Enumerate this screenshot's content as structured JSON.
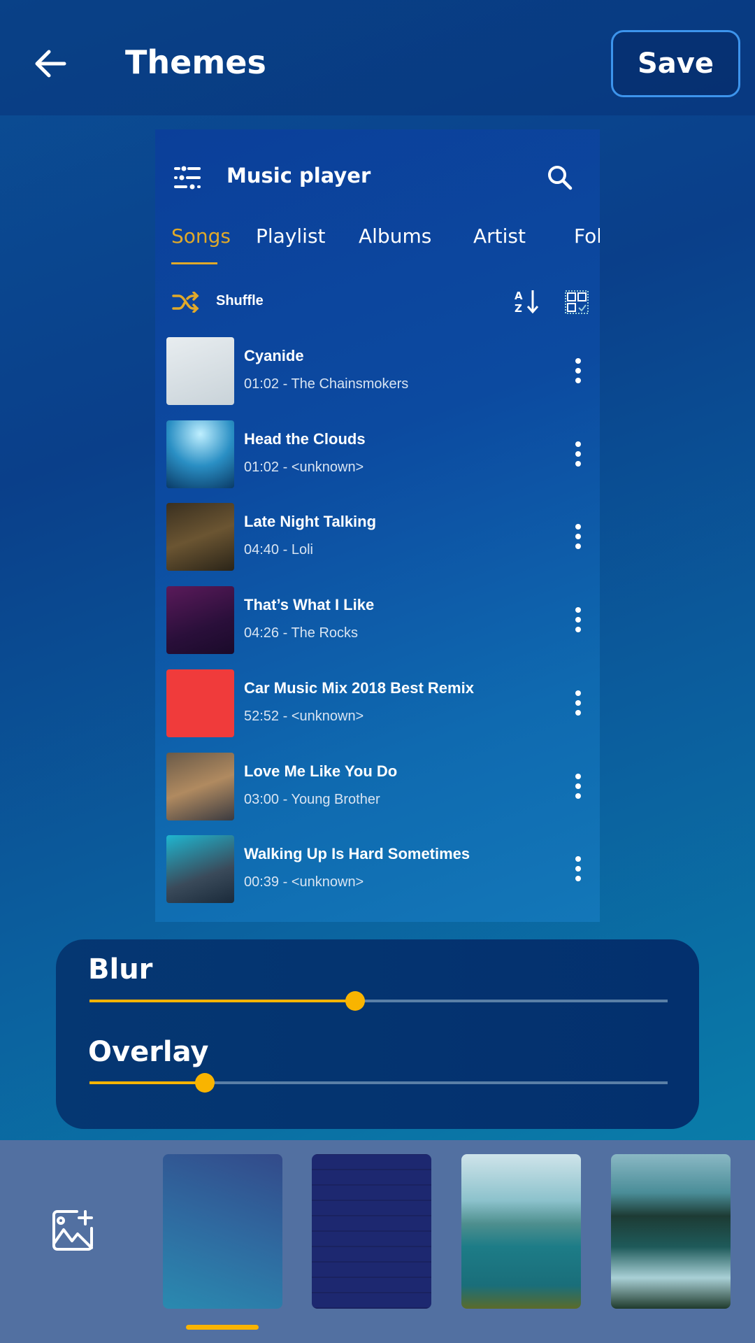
{
  "header": {
    "title": "Themes",
    "save_label": "Save",
    "back_icon": "arrow-left-icon"
  },
  "preview": {
    "title": "Music player",
    "tabs": [
      {
        "label": "Songs",
        "active": true
      },
      {
        "label": "Playlist"
      },
      {
        "label": "Albums"
      },
      {
        "label": "Artist"
      },
      {
        "label": "Fol"
      }
    ],
    "shuffle_label": "Shuffle",
    "accent": "#e0a92a",
    "songs": [
      {
        "title": "Cyanide",
        "subtitle": "01:02 - The Chainsmokers"
      },
      {
        "title": "Head the Clouds",
        "subtitle": "01:02 - <unknown>"
      },
      {
        "title": "Late Night Talking",
        "subtitle": "04:40 - Loli"
      },
      {
        "title": "That’s What I Like",
        "subtitle": "04:26 - The Rocks"
      },
      {
        "title": "Car Music Mix 2018 Best Remix",
        "subtitle": "52:52 - <unknown>"
      },
      {
        "title": "Love Me Like You Do",
        "subtitle": "03:00 - Young Brother"
      },
      {
        "title": "Walking Up Is Hard Sometimes",
        "subtitle": "00:39 - <unknown>"
      }
    ]
  },
  "sliders": {
    "blur": {
      "label": "Blur",
      "value": 0.46
    },
    "overlay": {
      "label": "Overlay",
      "value": 0.2
    },
    "color": "#f9b400"
  },
  "backgrounds": {
    "selected_index": 0,
    "items": [
      "gradient-blue",
      "dark-brick",
      "lake-island",
      "forest-lake"
    ]
  }
}
